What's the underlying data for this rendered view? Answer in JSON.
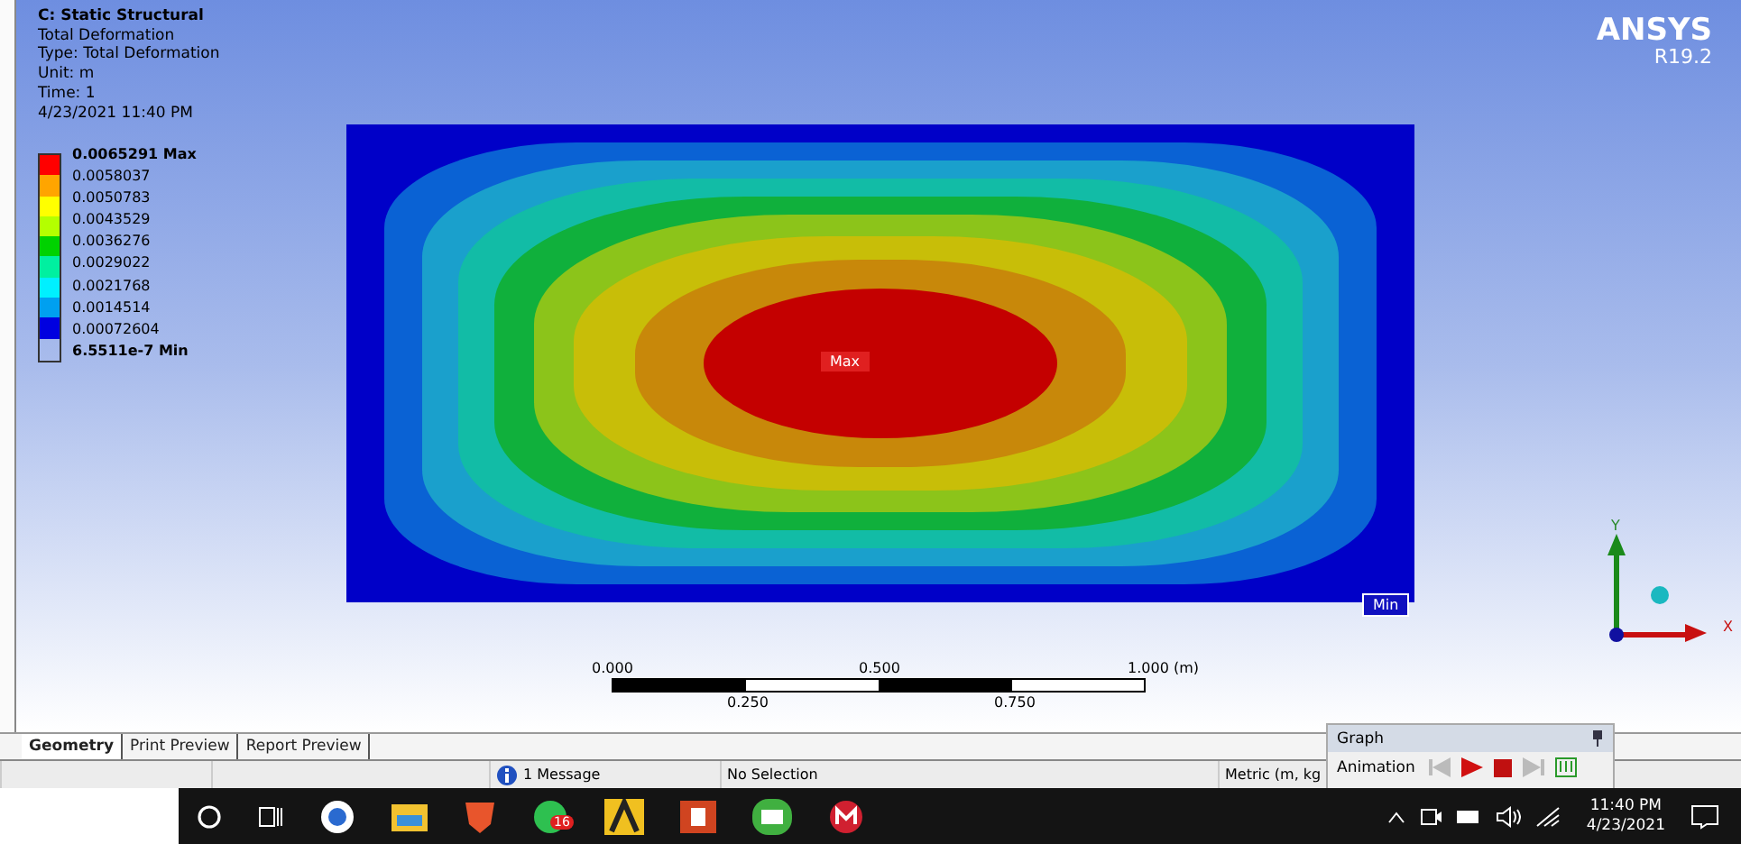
{
  "result_header": {
    "title": "C: Static Structural",
    "lines": [
      "Total Deformation",
      "Type: Total Deformation",
      "Unit: m",
      "Time: 1",
      "4/23/2021 11:40 PM"
    ]
  },
  "legend": {
    "labels": [
      "0.0065291 Max",
      "0.0058037",
      "0.0050783",
      "0.0043529",
      "0.0036276",
      "0.0029022",
      "0.0021768",
      "0.0014514",
      "0.00072604",
      "6.5511e-7 Min"
    ],
    "swatches": [
      {
        "color": "#ff0000"
      },
      {
        "color": "#ffa500"
      },
      {
        "color": "#ffff00"
      },
      {
        "color": "#b4ff00"
      },
      {
        "color": "#00d200"
      },
      {
        "color": "#00f0a0"
      },
      {
        "color": "#00f0ff"
      },
      {
        "color": "#00a0f0"
      },
      {
        "color": "#0000e0"
      }
    ]
  },
  "logo": {
    "name": "ANSYS",
    "version": "R19.2"
  },
  "plot": {
    "max_label": "Max",
    "min_label": "Min"
  },
  "scale_bar": {
    "top_labels": [
      "0.000",
      "0.500",
      "1.000 (m)"
    ],
    "bottom_labels": [
      "0.250",
      "0.750"
    ]
  },
  "triad": {
    "y_label": "Y",
    "x_label": "X"
  },
  "tabs": [
    {
      "label": "Geometry",
      "selected": true
    },
    {
      "label": "Print Preview",
      "selected": false
    },
    {
      "label": "Report Preview",
      "selected": false
    }
  ],
  "status_bar": {
    "message": "1 Message",
    "selection": "No Selection",
    "units": "Metric (m, kg"
  },
  "graph_panel": {
    "title": "Graph",
    "animation_label": "Animation"
  },
  "taskbar": {
    "whatsapp_badge": "16",
    "time": "11:40 PM",
    "date": "4/23/2021"
  }
}
